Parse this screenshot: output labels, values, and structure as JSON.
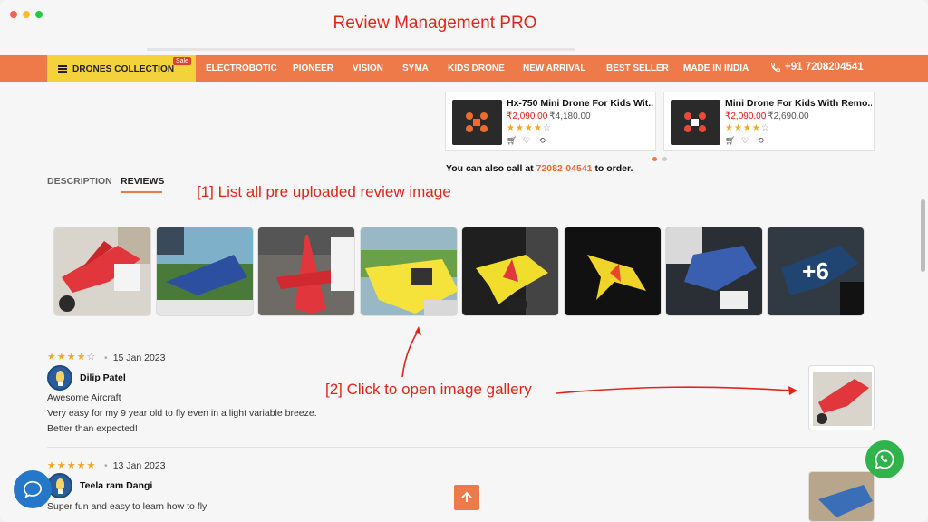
{
  "app": {
    "title": "Review Management PRO"
  },
  "nav": {
    "collection_label": "DRONES COLLECTION",
    "sale_badge": "Sale",
    "items": [
      "ELECTROBOTIC",
      "PIONEER",
      "VISION",
      "SYMA",
      "KIDS DRONE",
      "NEW ARRIVAL",
      "BEST SELLER",
      "MADE IN INDIA"
    ],
    "phone": "+91 7208204541"
  },
  "products": [
    {
      "name": "Hx-750 Mini Drone For Kids Wit...",
      "price": "₹2,090.00",
      "old_price": "₹4,180.00",
      "rating": 4
    },
    {
      "name": "Mini Drone For Kids With Remo...",
      "price": "₹2,090.00",
      "old_price": "₹2,690.00",
      "rating": 4
    }
  ],
  "call": {
    "prefix": "You can also call at",
    "number": "72082-04541",
    "suffix": "to order."
  },
  "tabs": {
    "description": "DESCRIPTION",
    "reviews": "REVIEWS"
  },
  "annotations": {
    "list_images": "[1] List all pre uploaded review image",
    "open_gallery": "[2] Click to open image gallery"
  },
  "gallery": {
    "more_count": "+6"
  },
  "reviews": [
    {
      "rating": 4,
      "date": "15 Jan 2023",
      "name": "Dilip Patel",
      "lines": [
        "Awesome Aircraft",
        "Very easy for my 9 year old to fly even in a light variable breeze.",
        "Better than expected!"
      ]
    },
    {
      "rating": 5,
      "date": "13 Jan 2023",
      "name": "Teela ram Dangi",
      "lines": [
        "Super fun and easy to learn how to fly"
      ]
    }
  ],
  "colors": {
    "accent": "#ee7a4a",
    "brand_red": "#e0261b",
    "nav_yellow": "#f4d23c",
    "star": "#f5a623"
  }
}
